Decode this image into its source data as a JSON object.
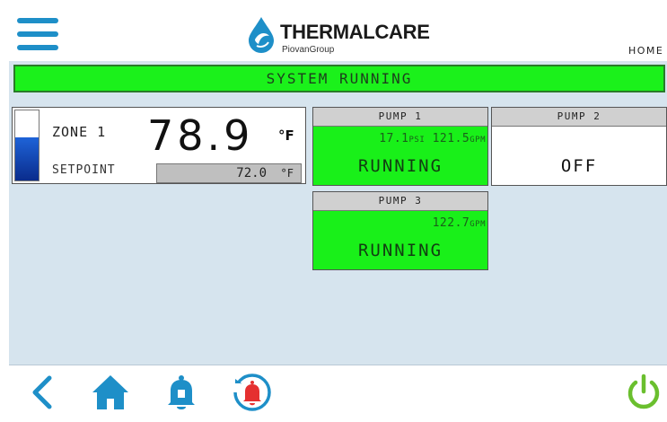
{
  "header": {
    "logo_title": "THERMALCARE",
    "logo_subtitle": "PiovanGroup",
    "home_link": "HOME",
    "menu_icon": "hamburger-menu-icon",
    "logo_icon": "water-drop-logo-icon"
  },
  "status": {
    "text": "SYSTEM RUNNING",
    "color": "#1bf11b"
  },
  "zone": {
    "label": "ZONE 1",
    "temperature": "78.9",
    "temperature_unit": "°F",
    "setpoint_label": "SETPOINT",
    "setpoint_value": "72.0",
    "setpoint_unit": "°F",
    "bar_level": 0.62
  },
  "pumps": [
    {
      "name": "PUMP 1",
      "pressure": "17.1",
      "pressure_unit": "PSI",
      "flow": "121.5",
      "flow_unit": "GPM",
      "state": "RUNNING"
    },
    {
      "name": "PUMP 2",
      "state": "OFF"
    },
    {
      "name": "PUMP 3",
      "flow": "122.7",
      "flow_unit": "GPM",
      "state": "RUNNING"
    }
  ],
  "footer": {
    "icons": [
      "back-icon",
      "home-icon",
      "alarm-bell-icon",
      "alarm-history-icon",
      "power-icon"
    ]
  },
  "colors": {
    "accent": "#1e8fc8",
    "running": "#19f019",
    "power": "#6abf2e",
    "alarm": "#e53030"
  }
}
